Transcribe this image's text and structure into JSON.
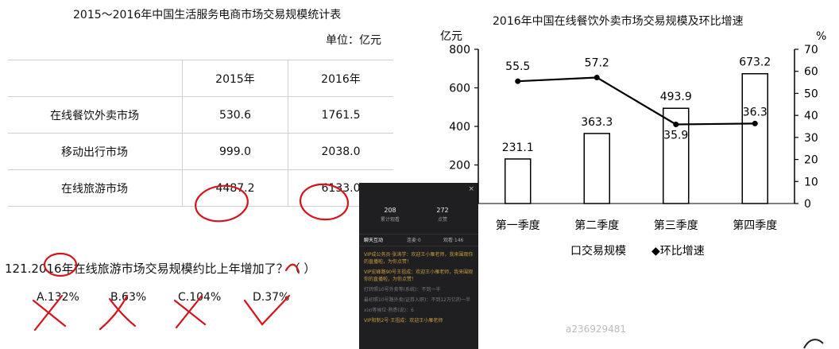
{
  "table": {
    "title": "2015～2016年中国生活服务电商市场交易规模统计表",
    "unit": "单位：亿元",
    "header": [
      "",
      "2015年",
      "2016年"
    ],
    "rows": [
      {
        "name": "在线餐饮外卖市场",
        "v2015": "530.6",
        "v2016": "1761.5"
      },
      {
        "name": "移动出行市场",
        "v2015": "999.0",
        "v2016": "2038.0"
      },
      {
        "name": "在线旅游市场",
        "v2015": "4487.2",
        "v2016": "6133.0"
      }
    ]
  },
  "question": {
    "text": "121.2016年在线旅游市场交易规模约比上年增加了？（ ）",
    "options": [
      "A.132%",
      "B.63%",
      "C.104%",
      "D.37%"
    ]
  },
  "overlay": {
    "close": "×",
    "stats": [
      {
        "num": "208",
        "label": "累计观看"
      },
      {
        "num": "272",
        "label": "点赞"
      }
    ],
    "tabs": [
      "聊天互动",
      "连麦·0",
      "观看·146"
    ],
    "messages": [
      {
        "text": "VIP成公务员·张涛学：欢迎王小雁老师，我来围观你的直播啦，为你点赞！",
        "style": "gold"
      },
      {
        "text": "VIP宏峰路90号王祖成：欢迎王小雁老师，我来围观你的直播啦，为你点赞！",
        "style": "gold"
      },
      {
        "text": "打转照10号外卖等(系统)：不到一半",
        "style": "grey"
      },
      {
        "text": "最初照10号路外卖(证券入职)：不到12万亿的一半",
        "style": "grey"
      },
      {
        "text": "xixi等候位·熟悉(说)：6",
        "style": "grey"
      },
      {
        "text": "VIP阳制2号·王祖成：欢迎王小雁老师",
        "style": "gold"
      }
    ]
  },
  "chart_data": {
    "type": "bar",
    "title": "2016年中国在线餐饮外卖市场交易规模及环比增速",
    "categories": [
      "第一季度",
      "第二季度",
      "第三季度",
      "第四季度"
    ],
    "series": [
      {
        "name": "交易规模",
        "type": "bar",
        "axis": "left",
        "values": [
          231.1,
          363.3,
          493.9,
          673.2
        ]
      },
      {
        "name": "环比增速",
        "type": "line",
        "axis": "right",
        "values": [
          55.5,
          57.2,
          35.9,
          36.3
        ]
      }
    ],
    "bar_labels": [
      "231.1",
      "363.3",
      "493.9",
      "673.2"
    ],
    "line_labels": [
      "55.5",
      "57.2",
      "35.9",
      "36.3"
    ],
    "ylabel_left": "亿元",
    "ylabel_right": "%",
    "ylim_left": [
      0,
      800
    ],
    "ylim_right": [
      0,
      70
    ],
    "yticks_left": [
      "200",
      "400",
      "600",
      "800"
    ],
    "yticks_right": [
      "0",
      "10",
      "20",
      "30",
      "40",
      "50",
      "60",
      "70"
    ],
    "legend": "bottom",
    "legend_labels": [
      "口交易规模",
      "◆环比增速"
    ],
    "grid": false
  },
  "watermark": "a236929481",
  "colors": {
    "annotation": "#d4141c",
    "overlay_bg": "#1f1f22",
    "overlay_gold": "#c89b3c"
  }
}
